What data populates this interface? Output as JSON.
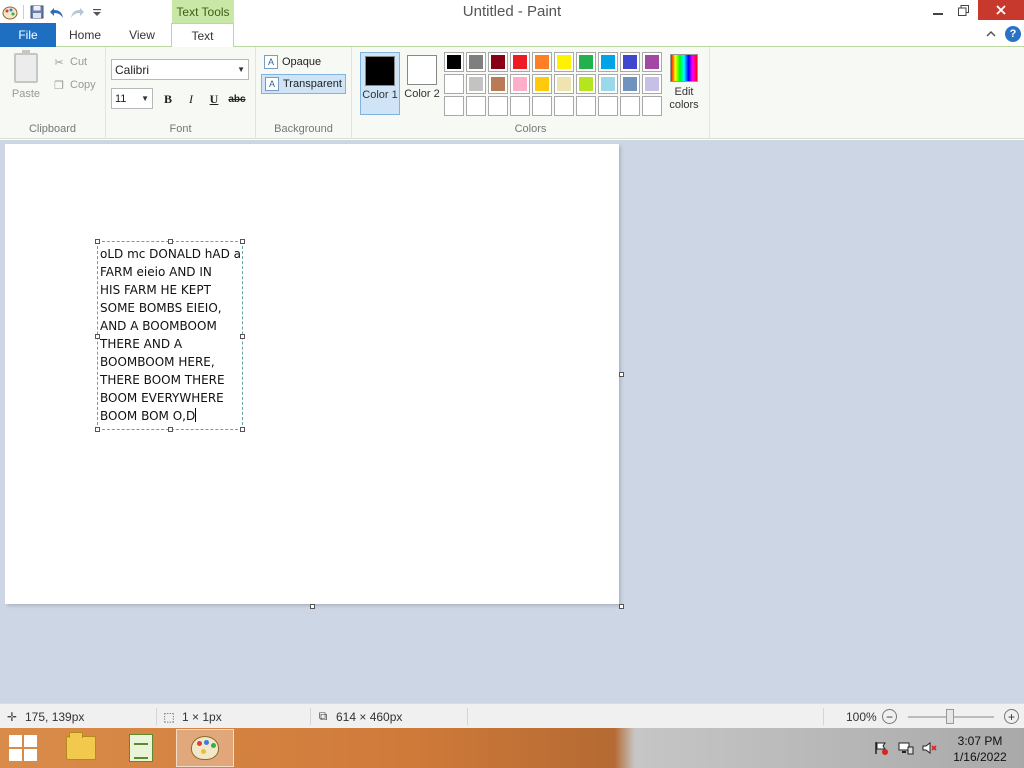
{
  "window": {
    "title": "Untitled - Paint",
    "contextual_tab": "Text Tools"
  },
  "tabs": [
    {
      "label": "File",
      "active": false
    },
    {
      "label": "Home",
      "active": false
    },
    {
      "label": "View",
      "active": false
    },
    {
      "label": "Text",
      "active": true
    }
  ],
  "ribbon": {
    "clipboard": {
      "label": "Clipboard",
      "paste": "Paste",
      "cut": "Cut",
      "copy": "Copy"
    },
    "font": {
      "label": "Font",
      "family": "Calibri",
      "size": "11",
      "bold": "B",
      "italic": "I",
      "underline": "U",
      "strikethrough": "abc"
    },
    "background": {
      "label": "Background",
      "opaque": "Opaque",
      "transparent": "Transparent",
      "selected": "Transparent"
    },
    "colors": {
      "label": "Colors",
      "color1_label": "Color 1",
      "color2_label": "Color 2",
      "color1_value": "#000000",
      "color2_value": "#ffffff",
      "edit_colors": "Edit colors",
      "palette_rows": [
        [
          "#000000",
          "#7f7f7f",
          "#880015",
          "#ed1c24",
          "#ff7f27",
          "#fff200",
          "#22b14c",
          "#00a2e8",
          "#3f48cc",
          "#a349a4"
        ],
        [
          "#ffffff",
          "#c3c3c3",
          "#b97a57",
          "#ffaec9",
          "#ffc90e",
          "#efe4b0",
          "#b5e61d",
          "#99d9ea",
          "#7092be",
          "#c8bfe7"
        ],
        [
          "",
          "",
          "",
          "",
          "",
          "",
          "",
          "",
          "",
          ""
        ]
      ]
    }
  },
  "canvas": {
    "text_lines": [
      "oLD mc DONALD hAD a",
      "FARM eieio AND IN",
      "HIS FARM HE KEPT",
      "SOME BOMBS EIEIO,",
      "AND A BOOMBOOM",
      "THERE AND A",
      "BOOMBOOM HERE,",
      "THERE BOOM THERE",
      "BOOM EVERYWHERE",
      "BOOM BOM O,D"
    ]
  },
  "statusbar": {
    "cursor_position": "175, 139px",
    "selection_size": "1 × 1px",
    "image_size": "614 × 460px",
    "zoom": "100%"
  },
  "taskbar": {
    "time": "3:07 PM",
    "date": "1/16/2022"
  }
}
